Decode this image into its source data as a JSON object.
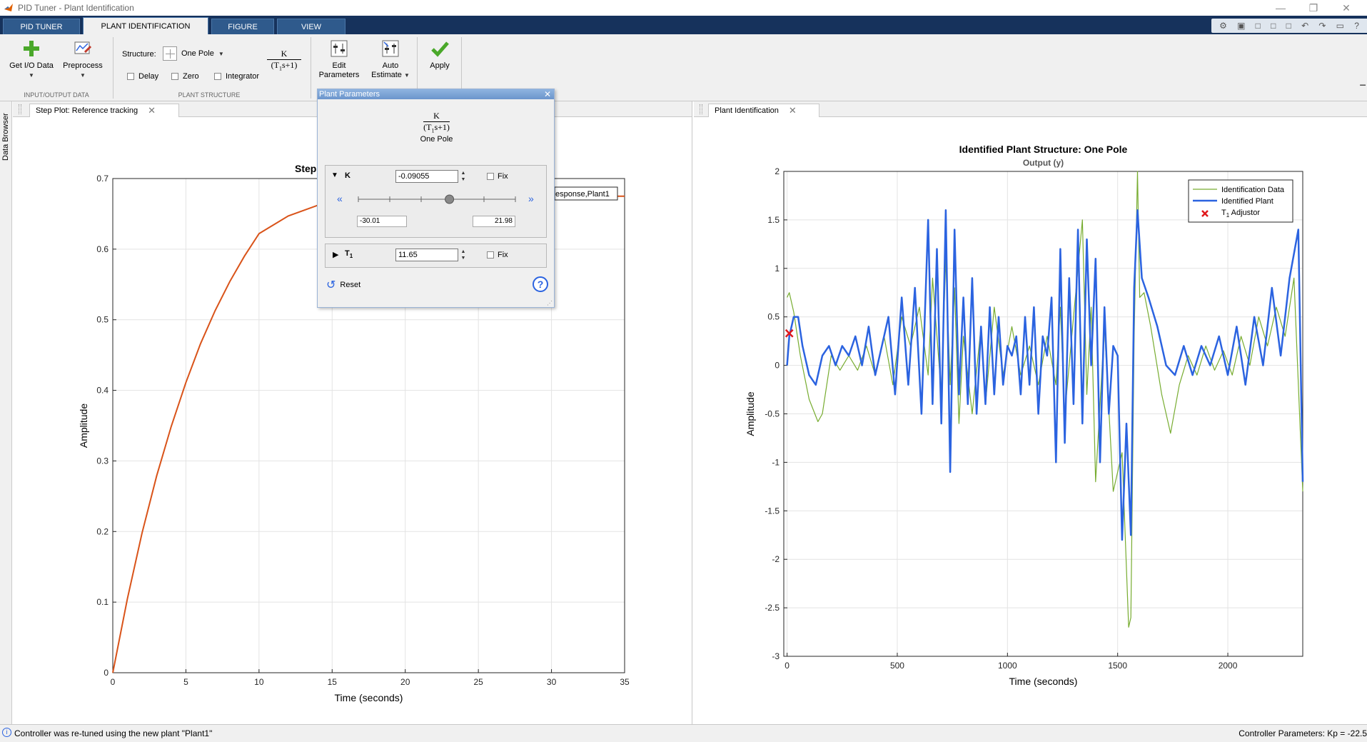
{
  "window": {
    "title": "PID Tuner - Plant Identification",
    "controls": [
      "—",
      "❐",
      "✕"
    ]
  },
  "tabs": [
    {
      "label": "PID TUNER"
    },
    {
      "label": "PLANT IDENTIFICATION"
    },
    {
      "label": "FIGURE"
    },
    {
      "label": "VIEW"
    }
  ],
  "quickbar": [
    "⚙",
    "▣",
    "□",
    "□",
    "□",
    "↶",
    "↷",
    "▭",
    "?"
  ],
  "ribbon": {
    "get_io_data": "Get I/O Data",
    "preprocess": "Preprocess",
    "structure_label": "Structure:",
    "structure_value": "One Pole",
    "formula_num": "K",
    "formula_den": "(T",
    "formula_den_sub": "1",
    "formula_den_tail": "s+1)",
    "delay": "Delay",
    "zero": "Zero",
    "integrator": "Integrator",
    "edit_parameters_1": "Edit",
    "edit_parameters_2": "Parameters",
    "auto_estimate_1": "Auto",
    "auto_estimate_2": "Estimate",
    "apply": "Apply",
    "section_io": "INPUT/OUTPUT DATA",
    "section_structure": "PLANT STRUCTURE"
  },
  "side_label": "Data Browser",
  "left_panel": {
    "tab_label": "Step Plot: Reference tracking",
    "title_partial": "Step",
    "legend_partial": "esponse,Plant1"
  },
  "right_panel": {
    "tab_label": "Plant Identification"
  },
  "popup": {
    "title": "Plant Parameters",
    "formula_num": "K",
    "formula_den": "(T",
    "formula_den_sub": "1",
    "formula_den_tail": "s+1)",
    "structure": "One Pole",
    "k_label": "K",
    "k_value": "-0.09055",
    "fix": "Fix",
    "slider_min": "-30.01",
    "slider_max": "21.98",
    "slider_fraction": 0.58,
    "t1_label": "T",
    "t1_sub": "1",
    "t1_value": "11.65",
    "reset": "Reset"
  },
  "status": {
    "message": "Controller was re-tuned using the new plant \"Plant1\"",
    "params": "Controller Parameters: Kp = -22.5"
  },
  "chart_data": [
    {
      "type": "line",
      "title": "Step",
      "xlabel": "Time (seconds)",
      "ylabel": "Amplitude",
      "xlim": [
        0,
        35
      ],
      "ylim": [
        0,
        0.7
      ],
      "xticks": [
        0,
        5,
        10,
        15,
        20,
        25,
        30,
        35
      ],
      "yticks": [
        0,
        0.1,
        0.2,
        0.3,
        0.4,
        0.5,
        0.6,
        0.7
      ],
      "grid": true,
      "series": [
        {
          "color": "#d95319",
          "x": [
            0,
            1,
            2,
            3,
            4,
            5,
            6,
            7,
            8,
            9,
            10,
            12,
            14,
            16,
            18,
            20,
            22,
            24,
            26,
            28,
            30,
            32,
            35
          ],
          "y": [
            0,
            0.105,
            0.198,
            0.279,
            0.349,
            0.411,
            0.466,
            0.513,
            0.554,
            0.59,
            0.622,
            0.647,
            0.662,
            0.669,
            0.672,
            0.674,
            0.675,
            0.675,
            0.675,
            0.675,
            0.675,
            0.675,
            0.675
          ]
        }
      ]
    },
    {
      "type": "line",
      "title": "Identified Plant Structure: One Pole",
      "subtitle": "Output (y)",
      "xlabel": "Time (seconds)",
      "ylabel": "Amplitude",
      "xlim": [
        -15,
        2340
      ],
      "ylim": [
        -3,
        2
      ],
      "xticks": [
        0,
        500,
        1000,
        1500,
        2000
      ],
      "yticks": [
        -3,
        -2.5,
        -2,
        -1.5,
        -1,
        -0.5,
        0,
        0.5,
        1,
        1.5,
        2
      ],
      "grid": true,
      "legend": "top-right",
      "legend_entries": [
        "Identification Data",
        "Identified Plant",
        "T",
        "Adjustor"
      ],
      "legend_sub": "1",
      "series": [
        {
          "name": "Identification Data",
          "color": "#77ac30",
          "x": [
            0,
            10,
            30,
            60,
            100,
            140,
            160,
            200,
            240,
            280,
            320,
            360,
            400,
            440,
            480,
            520,
            560,
            600,
            640,
            660,
            700,
            720,
            740,
            760,
            780,
            800,
            840,
            880,
            900,
            940,
            980,
            1020,
            1060,
            1100,
            1140,
            1180,
            1220,
            1240,
            1260,
            1300,
            1320,
            1340,
            1360,
            1380,
            1400,
            1440,
            1480,
            1520,
            1550,
            1560,
            1575,
            1590,
            1600,
            1620,
            1650,
            1700,
            1740,
            1780,
            1820,
            1860,
            1900,
            1940,
            1980,
            2020,
            2060,
            2100,
            2140,
            2180,
            2220,
            2260,
            2300,
            2340
          ],
          "y": [
            0.7,
            0.75,
            0.55,
            0.1,
            -0.35,
            -0.58,
            -0.5,
            0.1,
            -0.05,
            0.1,
            -0.05,
            0.2,
            -0.1,
            0.3,
            -0.2,
            0.5,
            0.2,
            0.6,
            -0.1,
            0.9,
            -0.3,
            1.1,
            -0.2,
            0.8,
            -0.6,
            0.3,
            -0.5,
            0.4,
            -0.4,
            0.6,
            -0.1,
            0.4,
            -0.1,
            0.2,
            -0.2,
            0.3,
            -0.2,
            0.6,
            -0.5,
            0.5,
            1.0,
            1.5,
            -0.3,
            0.6,
            -1.2,
            0.4,
            -1.3,
            -0.9,
            -2.7,
            -2.6,
            0.3,
            2.0,
            0.7,
            0.75,
            0.4,
            -0.3,
            -0.7,
            -0.2,
            0.1,
            -0.1,
            0.2,
            -0.05,
            0.15,
            -0.1,
            0.3,
            0.0,
            0.5,
            0.2,
            0.6,
            0.3,
            0.9,
            -1.3
          ]
        },
        {
          "name": "Identified Plant",
          "color": "#2b63e0",
          "x": [
            0,
            10,
            30,
            50,
            70,
            100,
            130,
            160,
            190,
            220,
            250,
            280,
            310,
            340,
            370,
            400,
            430,
            460,
            490,
            520,
            550,
            580,
            610,
            640,
            660,
            680,
            700,
            720,
            740,
            760,
            780,
            800,
            820,
            840,
            860,
            880,
            900,
            920,
            940,
            960,
            980,
            1000,
            1020,
            1040,
            1060,
            1080,
            1100,
            1120,
            1140,
            1160,
            1180,
            1200,
            1220,
            1240,
            1260,
            1280,
            1300,
            1320,
            1340,
            1360,
            1380,
            1400,
            1420,
            1440,
            1460,
            1480,
            1500,
            1520,
            1540,
            1560,
            1575,
            1590,
            1610,
            1640,
            1680,
            1720,
            1760,
            1800,
            1840,
            1880,
            1920,
            1960,
            2000,
            2040,
            2080,
            2120,
            2160,
            2200,
            2240,
            2280,
            2320,
            2340
          ],
          "y": [
            0.0,
            0.3,
            0.5,
            0.5,
            0.2,
            -0.1,
            -0.2,
            0.1,
            0.2,
            0.0,
            0.2,
            0.1,
            0.3,
            0.0,
            0.4,
            -0.1,
            0.2,
            0.5,
            -0.3,
            0.7,
            -0.2,
            0.8,
            -0.5,
            1.5,
            -0.4,
            1.2,
            -0.6,
            1.6,
            -1.1,
            1.4,
            -0.3,
            0.7,
            -0.4,
            0.9,
            -0.5,
            0.4,
            -0.4,
            0.6,
            -0.3,
            0.5,
            -0.2,
            0.2,
            0.1,
            0.3,
            -0.3,
            0.5,
            -0.2,
            0.6,
            -0.5,
            0.3,
            0.1,
            0.7,
            -1.0,
            1.2,
            -0.8,
            0.9,
            -0.4,
            1.4,
            -0.6,
            1.3,
            0.0,
            1.1,
            -1.0,
            0.6,
            -0.5,
            0.2,
            0.1,
            -1.8,
            -0.6,
            -1.75,
            0.8,
            1.6,
            0.9,
            0.7,
            0.4,
            0.0,
            -0.1,
            0.2,
            -0.1,
            0.2,
            0.0,
            0.3,
            -0.1,
            0.4,
            -0.2,
            0.5,
            0.0,
            0.8,
            0.1,
            0.9,
            1.4,
            -1.2
          ]
        },
        {
          "name": "T1 Adjustor",
          "color": "#e0181b",
          "marker": "x",
          "x": [
            10
          ],
          "y": [
            0.33
          ]
        }
      ]
    }
  ]
}
